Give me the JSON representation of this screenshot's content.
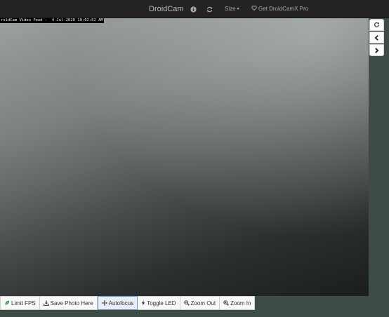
{
  "navbar": {
    "brand": "DroidCam",
    "info_icon": "info-circle-icon",
    "refresh_icon": "refresh-icon",
    "size_label": "Size",
    "pro_label": "Get DroidCamX Pro",
    "pro_icon": "heart-icon"
  },
  "video": {
    "overlay_text": "roidCam Video Feed -  4-Jul-2020 10:02:52 AM"
  },
  "side_buttons": [
    {
      "icon": "refresh-icon"
    },
    {
      "icon": "chevron-left-icon"
    },
    {
      "icon": "chevron-right-icon"
    }
  ],
  "toolbar": {
    "limit_fps": "Limit FPS",
    "save_photo": "Save Photo Here",
    "autofocus": "Autofocus",
    "toggle_led": "Toggle LED",
    "zoom_out": "Zoom Out",
    "zoom_in": "Zoom In"
  },
  "colors": {
    "navbar_bg": "#232323",
    "page_bg": "#3f4b45",
    "leaf_green": "#3c9a3c",
    "active_border": "#6d95c7"
  }
}
